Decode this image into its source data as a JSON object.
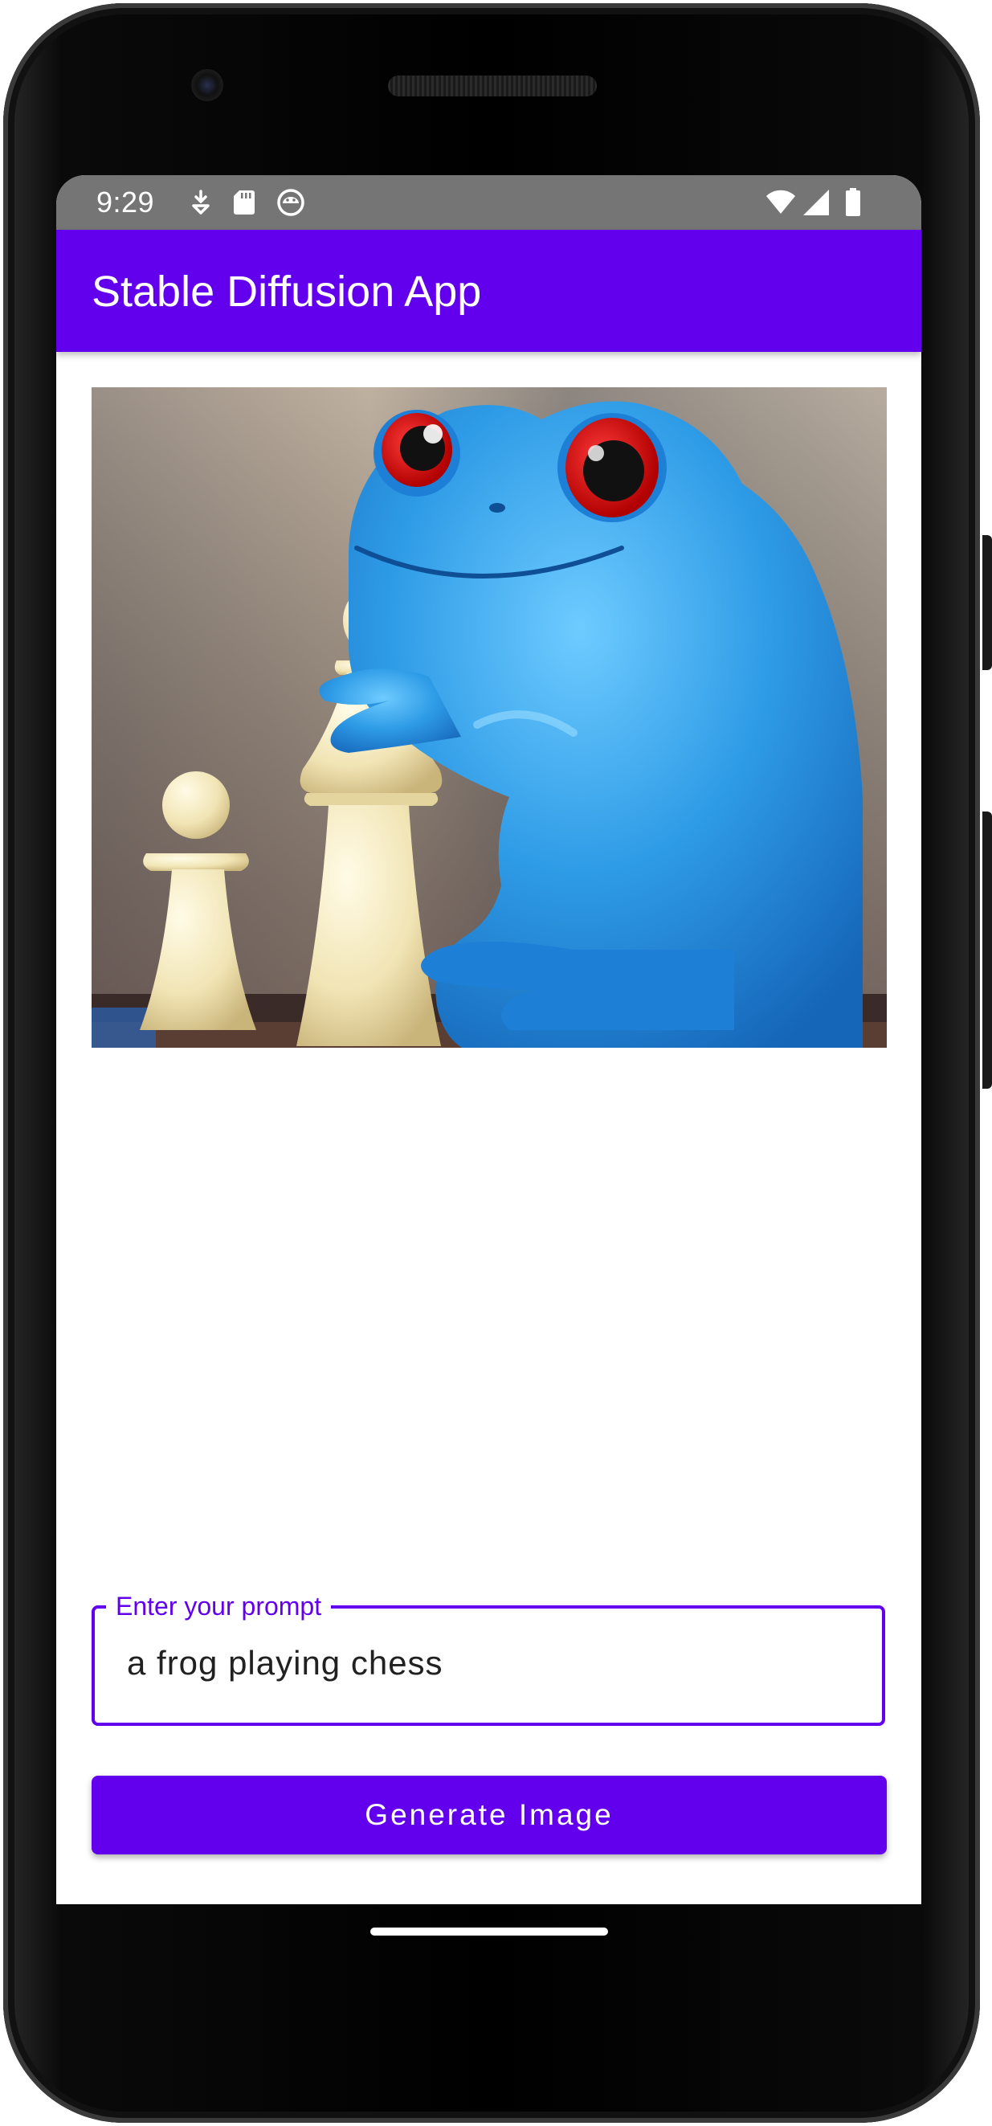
{
  "status_bar": {
    "time": "9:29",
    "left_icons": [
      "download-notification-icon",
      "sd-card-icon",
      "android-debug-icon"
    ],
    "right_icons": [
      "wifi-icon",
      "cell-signal-icon",
      "battery-icon"
    ],
    "background_color": "#757575"
  },
  "app_bar": {
    "title": "Stable Diffusion App",
    "color": "#6200EE"
  },
  "main": {
    "generated_image": {
      "subject": "blue frog with red eyes beside chess pieces"
    },
    "prompt": {
      "label": "Enter your prompt",
      "value": "a frog playing chess"
    },
    "generate_button": {
      "label": "Generate Image"
    }
  },
  "accent_color": "#6200EE"
}
